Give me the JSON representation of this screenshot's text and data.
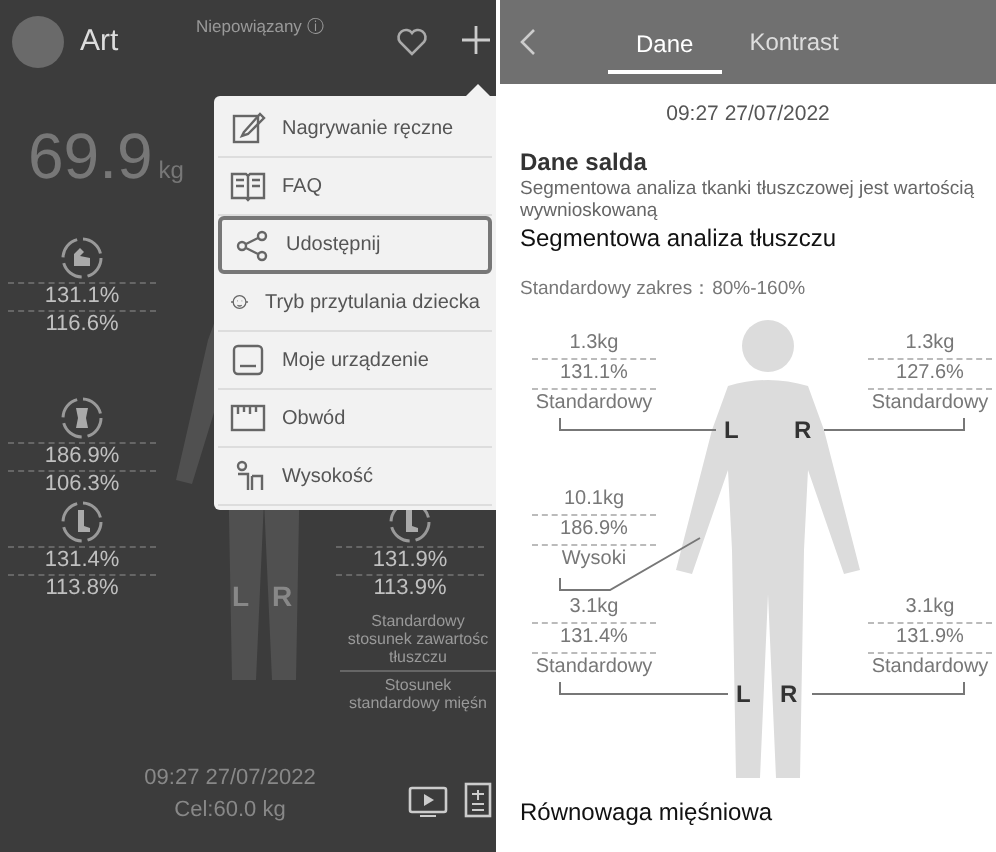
{
  "left": {
    "name": "Art",
    "status": "Niepowiązany",
    "status_mark": "ⓘ",
    "weight": {
      "value": "69.9",
      "unit": "kg"
    },
    "segments": [
      {
        "fat": "131.1%",
        "muscle": "116.6%"
      },
      {
        "fat": "186.9%",
        "muscle": "106.3%"
      },
      {
        "fat": "131.4%",
        "muscle": "113.8%"
      },
      {
        "fat": "131.9%",
        "muscle": "113.9%"
      }
    ],
    "side_labels": [
      "L",
      "R"
    ],
    "legend": [
      "Standardowy stosunek zawartośc tłuszczu",
      "Stosunek standardowy mięśn"
    ],
    "time": "09:27 27/07/2022",
    "goal": "Cel:60.0 kg"
  },
  "menu": {
    "items": [
      {
        "label": "Nagrywanie ręczne",
        "selected": false
      },
      {
        "label": "FAQ",
        "selected": false
      },
      {
        "label": "Udostępnij",
        "selected": true
      },
      {
        "label": "Tryb przytulania dziecka",
        "selected": false
      },
      {
        "label": "Moje urządzenie",
        "selected": false
      },
      {
        "label": "Obwód",
        "selected": false
      },
      {
        "label": "Wysokość",
        "selected": false
      }
    ]
  },
  "right": {
    "tabs": [
      {
        "label": "Dane",
        "selected": true
      },
      {
        "label": "Kontrast",
        "selected": false
      }
    ],
    "date": "09:27 27/07/2022",
    "section_title": "Dane salda",
    "note": "Segmentowa analiza tkanki tłuszczowej jest wartością wywnioskowaną",
    "heading": "Segmentowa analiza tłuszczu",
    "range": "Standardowy zakres：80%-160%",
    "segments": [
      {
        "mass": "1.3kg",
        "percent": "131.1%",
        "rating": "Standardowy"
      },
      {
        "mass": "1.3kg",
        "percent": "127.6%",
        "rating": "Standardowy"
      },
      {
        "mass": "10.1kg",
        "percent": "186.9%",
        "rating": "Wysoki"
      },
      {
        "mass": "3.1kg",
        "percent": "131.4%",
        "rating": "Standardowy"
      },
      {
        "mass": "3.1kg",
        "percent": "131.9%",
        "rating": "Standardowy"
      }
    ],
    "arm_labels": [
      "L",
      "R"
    ],
    "leg_labels": [
      "L",
      "R"
    ],
    "footer_title": "Równowaga mięśniowa"
  }
}
